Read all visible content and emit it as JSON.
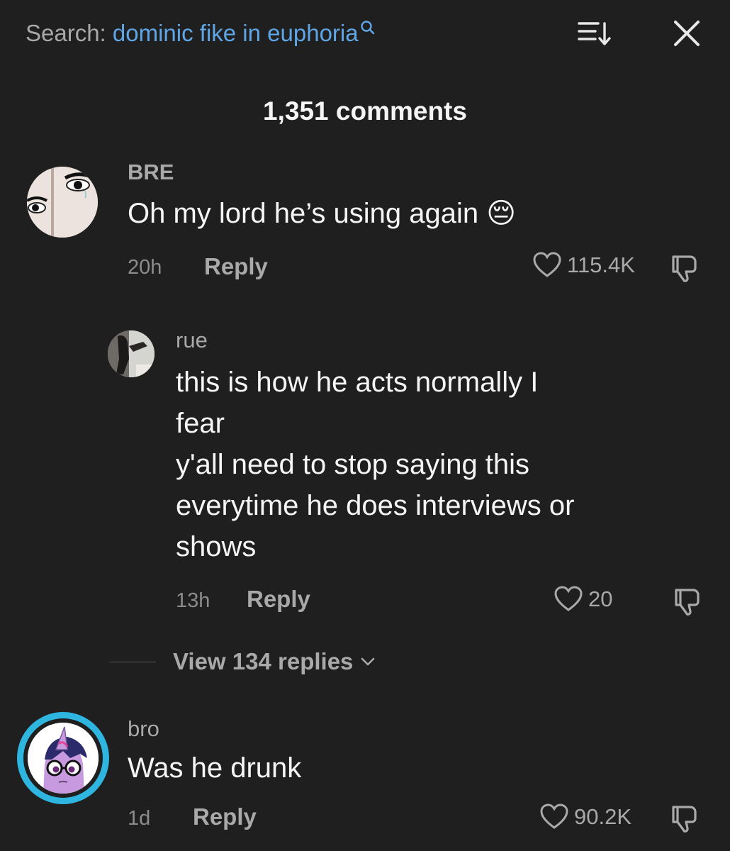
{
  "header": {
    "search_prefix": "Search:",
    "search_query": "dominic fike in euphoria",
    "search_icon": "search-icon",
    "sort_icon": "sort-icon",
    "close_icon": "close-icon"
  },
  "comment_count": "1,351 comments",
  "comments": [
    {
      "username": "BRE",
      "text": "Oh my lord he’s using again",
      "emoji": "😔",
      "time": "20h",
      "reply_label": "Reply",
      "likes": "115.4K"
    },
    {
      "username": "rue",
      "text_lines": [
        "this is how he acts normally I",
        "fear",
        "y'all need to stop saying this",
        "everytime he does interviews or",
        "shows"
      ],
      "time": "13h",
      "reply_label": "Reply",
      "likes": "20"
    },
    {
      "username": "bro",
      "text": "Was he drunk",
      "time": "1d",
      "reply_label": "Reply",
      "likes": "90.2K"
    }
  ],
  "view_replies": "View 134 replies",
  "colors": {
    "background": "#1f1f1f",
    "search_query": "#5fa6e6",
    "secondary_text": "#a9a9a9",
    "avatar_ring": "#2fb6e0"
  }
}
